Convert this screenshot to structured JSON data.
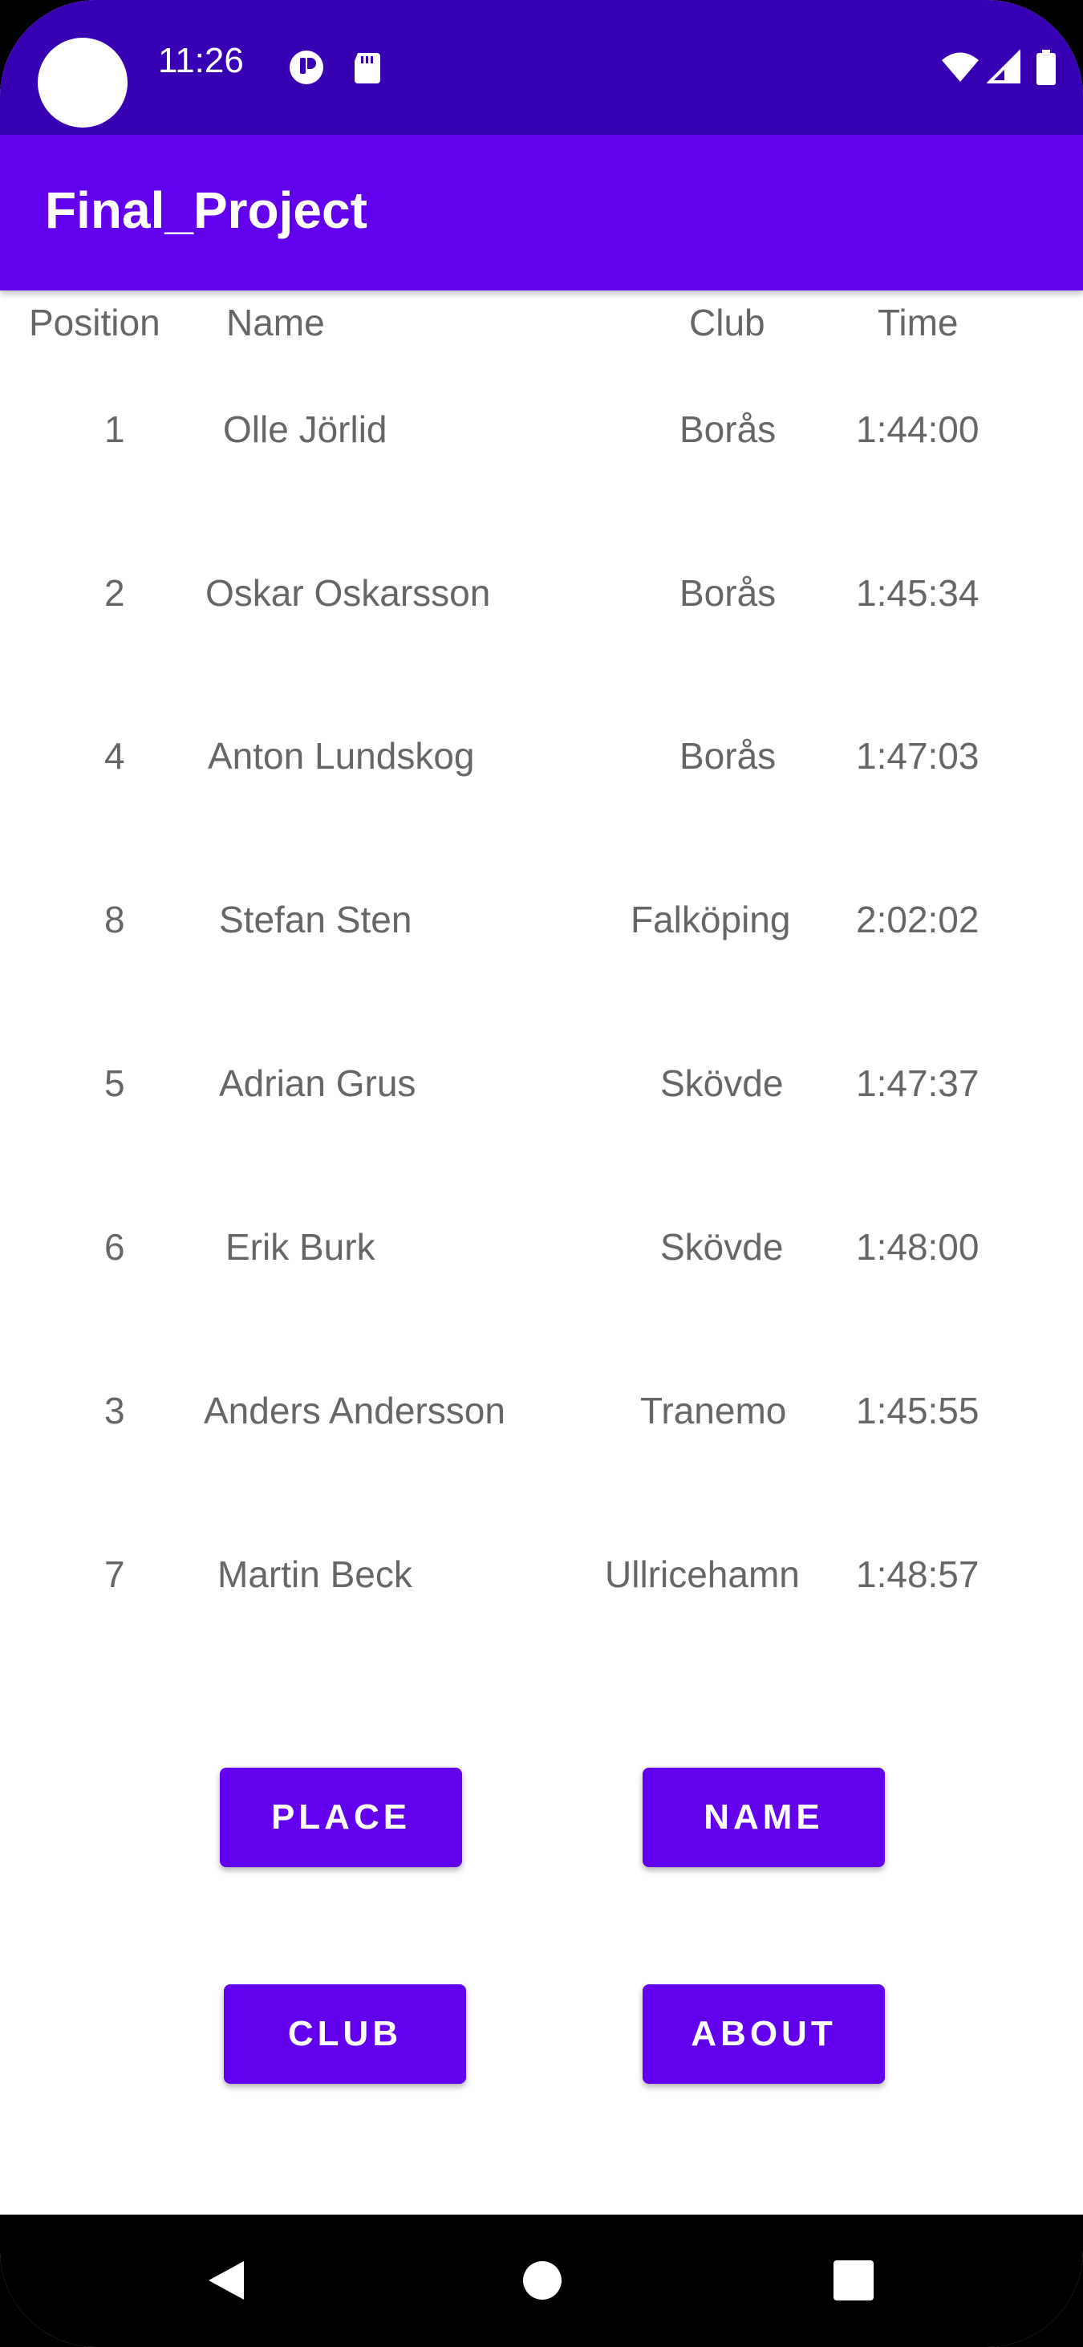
{
  "status_bar": {
    "time": "11:26",
    "icons": [
      "notification-app-icon",
      "sd-card-icon",
      "wifi-icon",
      "signal-icon",
      "battery-icon"
    ]
  },
  "app_bar": {
    "title": "Final_Project"
  },
  "table": {
    "headers": {
      "position": "Position",
      "name": "Name",
      "club": "Club",
      "time": "Time"
    },
    "rows": [
      {
        "position": "1",
        "name": "Olle Jörlid",
        "club": "Borås",
        "time": "1:44:00"
      },
      {
        "position": "2",
        "name": "Oskar Oskarsson",
        "club": "Borås",
        "time": "1:45:34"
      },
      {
        "position": "4",
        "name": "Anton Lundskog",
        "club": "Borås",
        "time": "1:47:03"
      },
      {
        "position": "8",
        "name": "Stefan Sten",
        "club": "Falköping",
        "time": "2:02:02"
      },
      {
        "position": "5",
        "name": "Adrian Grus",
        "club": "Skövde",
        "time": "1:47:37"
      },
      {
        "position": "6",
        "name": "Erik Burk",
        "club": "Skövde",
        "time": "1:48:00"
      },
      {
        "position": "3",
        "name": "Anders Andersson",
        "club": "Tranemo",
        "time": "1:45:55"
      },
      {
        "position": "7",
        "name": "Martin Beck",
        "club": "Ullricehamn",
        "time": "1:48:57"
      }
    ]
  },
  "buttons": {
    "place": "PLACE",
    "name": "NAME",
    "club": "CLUB",
    "about": "ABOUT"
  },
  "colors": {
    "status_bar": "#3700B3",
    "app_bar": "#6200EE",
    "button": "#6200EE",
    "text_secondary": "#666666"
  },
  "nav_bar": {
    "icons": [
      "back-icon",
      "home-icon",
      "recents-icon"
    ]
  }
}
